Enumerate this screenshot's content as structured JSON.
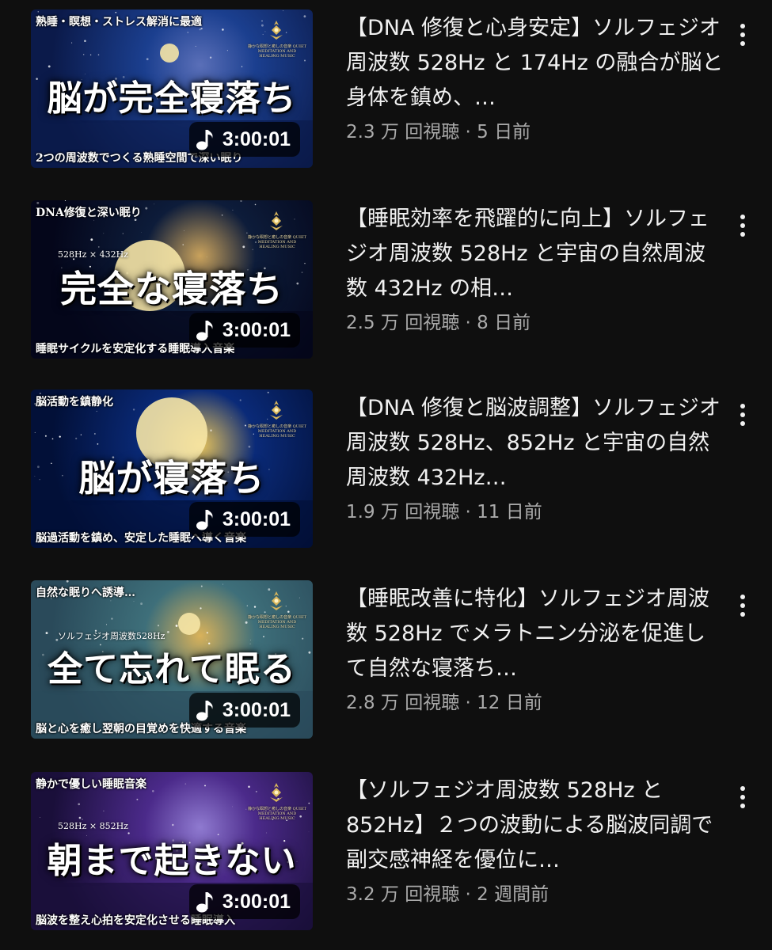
{
  "videos": [
    {
      "thumbnail": {
        "top_text": "熟睡・瞑想・ストレス解消に最適",
        "sub_text": "",
        "main_text": "脳が完全寝落ち",
        "bottom_text": "2つの周波数でつくる熟睡空間で深い眠り",
        "emblem_caption": "静かな瞑想と癒しの音楽 QUIET MEDITATION AND HEALING MUSIC",
        "palette": [
          "#0b1a4a",
          "#1b3f8f",
          "#5a6fb8"
        ],
        "duration": "3:00:01"
      },
      "title": "【DNA 修復と心身安定】ソルフェジオ周波数 528Hz と 174Hz の融合が脳と身体を鎮め、…",
      "stats": "2.3 万 回視聴 · 5 日前"
    },
    {
      "thumbnail": {
        "top_text": "DNA修復と深い眠り",
        "sub_text": "528Hz × 432Hz",
        "main_text": "完全な寝落ち",
        "bottom_text": "睡眠サイクルを安定化する睡眠導入音楽",
        "emblem_caption": "静かな瞑想と癒しの音楽 QUIET MEDITATION AND HEALING MUSIC",
        "palette": [
          "#04061a",
          "#0d1c3a",
          "#c9a25c"
        ],
        "duration": "3:00:01"
      },
      "title": "【睡眠効率を飛躍的に向上】ソルフェジオ周波数 528Hz と宇宙の自然周波数 432Hz の相…",
      "stats": "2.5 万 回視聴 · 8 日前"
    },
    {
      "thumbnail": {
        "top_text": "脳活動を鎮静化",
        "sub_text": "",
        "main_text": "脳が寝落ち",
        "bottom_text": "脳過活動を鎮め、安定した睡眠へ導く音楽",
        "emblem_caption": "静かな瞑想と癒しの音楽 QUIET MEDITATION AND HEALING MUSIC",
        "palette": [
          "#021038",
          "#0a2a78",
          "#e7c35a"
        ],
        "duration": "3:00:01"
      },
      "title": "【DNA 修復と脳波調整】ソルフェジオ周波数 528Hz、852Hz と宇宙の自然周波数 432Hz…",
      "stats": "1.9 万 回視聴 · 11 日前"
    },
    {
      "thumbnail": {
        "top_text": "自然な眠りへ誘導…",
        "sub_text": "ソルフェジオ周波数528Hz",
        "main_text": "全て忘れて眠る",
        "bottom_text": "脳と心を癒し翌朝の目覚めを快適する音楽",
        "emblem_caption": "静かな瞑想と癒しの音楽 QUIET MEDITATION AND HEALING MUSIC",
        "palette": [
          "#2a4a5a",
          "#3e6f7a",
          "#d9b25a"
        ],
        "duration": "3:00:01"
      },
      "title": "【睡眠改善に特化】ソルフェジオ周波数 528Hz でメラトニン分泌を促進して自然な寝落ち…",
      "stats": "2.8 万 回視聴 · 12 日前"
    },
    {
      "thumbnail": {
        "top_text": "静かで優しい睡眠音楽",
        "sub_text": "528Hz × 852Hz",
        "main_text": "朝まで起きない",
        "bottom_text": "脳波を整え心拍を安定化させる睡眠導入",
        "emblem_caption": "静かな瞑想と癒しの音楽 QUIET MEDITATION AND HEALING MUSIC",
        "palette": [
          "#1a0f3a",
          "#4b2a8a",
          "#8f7ad0"
        ],
        "duration": "3:00:01"
      },
      "title": "【ソルフェジオ周波数 528Hz と 852Hz】２つの波動による脳波同調で副交感神経を優位に…",
      "stats": "3.2 万 回視聴 · 2 週間前"
    }
  ]
}
